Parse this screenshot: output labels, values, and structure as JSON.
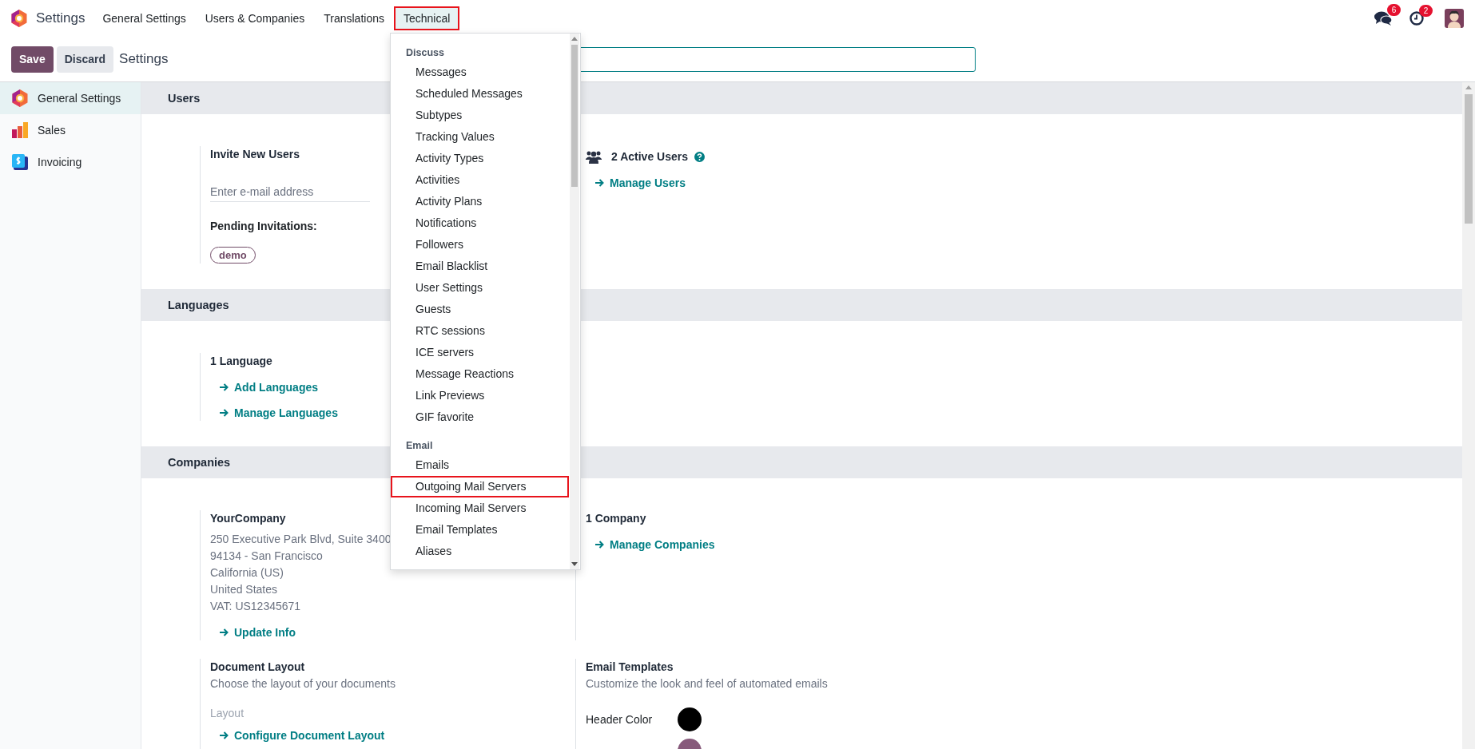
{
  "navbar": {
    "app_title": "Settings",
    "menus": [
      {
        "label": "General Settings",
        "selected": false,
        "annotated": false
      },
      {
        "label": "Users & Companies",
        "selected": false,
        "annotated": false
      },
      {
        "label": "Translations",
        "selected": false,
        "annotated": false
      },
      {
        "label": "Technical",
        "selected": true,
        "annotated": true
      }
    ],
    "messages_badge": "6",
    "activities_badge": "2"
  },
  "control_panel": {
    "buttons": [
      {
        "label": "Save",
        "kind": "primary"
      },
      {
        "label": "Discard",
        "kind": "secondary"
      }
    ],
    "breadcrumb": "Settings"
  },
  "sidebar": {
    "items": [
      {
        "label": "General Settings",
        "selected": true,
        "kind": "general"
      },
      {
        "label": "Sales",
        "selected": false,
        "kind": "sales"
      },
      {
        "label": "Invoicing",
        "selected": false,
        "kind": "invoicing"
      }
    ]
  },
  "technical_menu": {
    "groups": [
      {
        "title": "Discuss",
        "items": [
          {
            "label": "Messages",
            "annotated": false
          },
          {
            "label": "Scheduled Messages",
            "annotated": false
          },
          {
            "label": "Subtypes",
            "annotated": false
          },
          {
            "label": "Tracking Values",
            "annotated": false
          },
          {
            "label": "Activity Types",
            "annotated": false
          },
          {
            "label": "Activities",
            "annotated": false
          },
          {
            "label": "Activity Plans",
            "annotated": false
          },
          {
            "label": "Notifications",
            "annotated": false
          },
          {
            "label": "Followers",
            "annotated": false
          },
          {
            "label": "Email Blacklist",
            "annotated": false
          },
          {
            "label": "User Settings",
            "annotated": false
          },
          {
            "label": "Guests",
            "annotated": false
          },
          {
            "label": "RTC sessions",
            "annotated": false
          },
          {
            "label": "ICE servers",
            "annotated": false
          },
          {
            "label": "Message Reactions",
            "annotated": false
          },
          {
            "label": "Link Previews",
            "annotated": false
          },
          {
            "label": "GIF favorite",
            "annotated": false
          }
        ]
      },
      {
        "title": "Email",
        "items": [
          {
            "label": "Emails",
            "annotated": false
          },
          {
            "label": "Outgoing Mail Servers",
            "annotated": true
          },
          {
            "label": "Incoming Mail Servers",
            "annotated": false
          },
          {
            "label": "Email Templates",
            "annotated": false
          },
          {
            "label": "Aliases",
            "annotated": false
          }
        ]
      }
    ]
  },
  "sections": [
    {
      "title": "Users",
      "rows": [
        [
          {
            "kind": "invite",
            "title": "Invite New Users",
            "placeholder": "Enter e-mail address",
            "pending_label": "Pending Invitations:",
            "tags": [
              "demo"
            ]
          },
          {
            "kind": "users",
            "title": "2 Active Users",
            "help": true,
            "links": [
              "Manage Users"
            ]
          }
        ]
      ]
    },
    {
      "title": "Languages",
      "rows": [
        [
          {
            "kind": "stat",
            "title": "1 Language",
            "links": [
              "Add Languages",
              "Manage Languages"
            ]
          }
        ]
      ]
    },
    {
      "title": "Companies",
      "rows": [
        [
          {
            "kind": "company",
            "title": "YourCompany",
            "lines": [
              "250 Executive Park Blvd, Suite 3400",
              "94134 - San Francisco",
              "California (US)",
              "United States",
              "VAT:  US12345671"
            ],
            "links": [
              "Update Info"
            ]
          },
          {
            "kind": "stat",
            "title": "1 Company",
            "links": [
              "Manage Companies"
            ]
          }
        ],
        [
          {
            "kind": "layout",
            "title": "Document Layout",
            "description": "Choose the layout of your documents",
            "field_label": "Layout",
            "links": [
              "Configure Document Layout"
            ]
          },
          {
            "kind": "colors",
            "title": "Email Templates",
            "description": "Customize the look and feel of automated emails",
            "colors": [
              {
                "label": "Header Color",
                "color": "#000000"
              },
              {
                "color": "#875a7b"
              }
            ]
          }
        ]
      ]
    }
  ]
}
